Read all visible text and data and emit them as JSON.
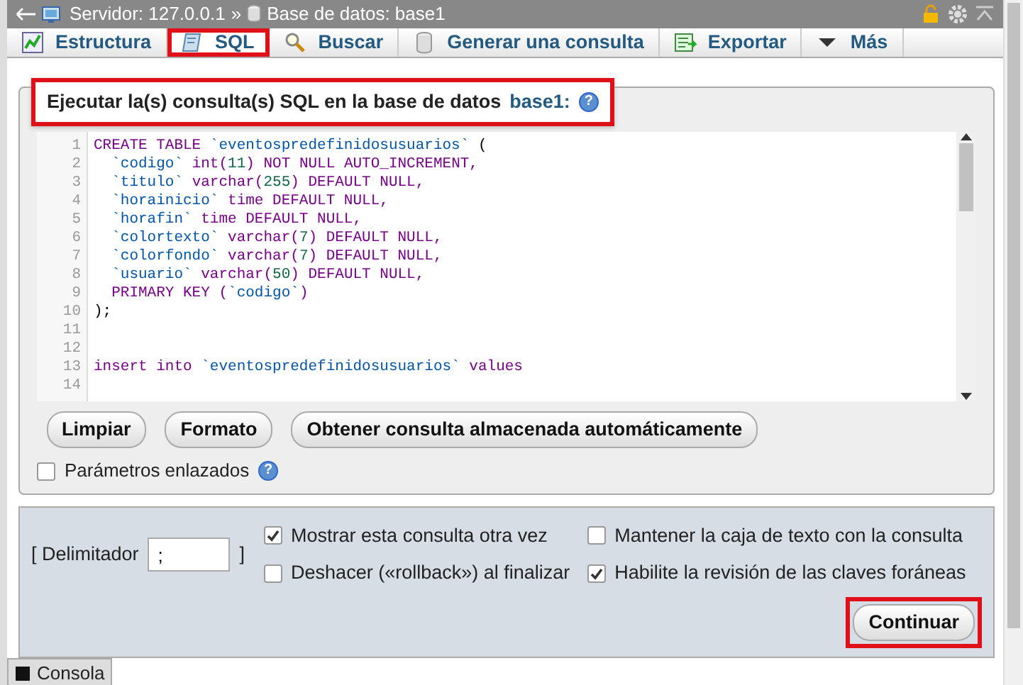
{
  "breadcrumb": {
    "server": "Servidor: 127.0.0.1",
    "separator": "»",
    "database": "Base de datos: base1"
  },
  "tabs": [
    {
      "label": "Estructura",
      "selected": false,
      "highlighted": false
    },
    {
      "label": "SQL",
      "selected": true,
      "highlighted": true
    },
    {
      "label": "Buscar",
      "selected": false,
      "highlighted": false
    },
    {
      "label": "Generar una consulta",
      "selected": false,
      "highlighted": false
    },
    {
      "label": "Exportar",
      "selected": false,
      "highlighted": false
    },
    {
      "label": "Más",
      "selected": false,
      "highlighted": false
    }
  ],
  "legend": {
    "text": "Ejecutar la(s) consulta(s) SQL en la base de datos",
    "database": "base1:",
    "help": "?",
    "highlighted": true
  },
  "editor": {
    "lines": [
      {
        "number": "1",
        "segments": [
          {
            "t": "CREATE TABLE ",
            "kind": "kw"
          },
          {
            "t": "`eventospredefinidosusuarios`",
            "kind": "name"
          },
          {
            "t": " (",
            "kind": "plain"
          }
        ]
      },
      {
        "number": "2",
        "segments": [
          {
            "t": "  `codigo`",
            "kind": "name"
          },
          {
            "t": " int(",
            "kind": "type"
          },
          {
            "t": "11",
            "kind": "num"
          },
          {
            "t": ") NOT NULL AUTO_INCREMENT,",
            "kind": "kw"
          }
        ]
      },
      {
        "number": "3",
        "segments": [
          {
            "t": "  `titulo`",
            "kind": "name"
          },
          {
            "t": " varchar(",
            "kind": "type"
          },
          {
            "t": "255",
            "kind": "num"
          },
          {
            "t": ") DEFAULT NULL,",
            "kind": "kw"
          }
        ]
      },
      {
        "number": "4",
        "segments": [
          {
            "t": "  `horainicio`",
            "kind": "name"
          },
          {
            "t": " time DEFAULT NULL,",
            "kind": "kw"
          }
        ]
      },
      {
        "number": "5",
        "segments": [
          {
            "t": "  `horafin`",
            "kind": "name"
          },
          {
            "t": " time DEFAULT NULL,",
            "kind": "kw"
          }
        ]
      },
      {
        "number": "6",
        "segments": [
          {
            "t": "  `colortexto`",
            "kind": "name"
          },
          {
            "t": " varchar(",
            "kind": "type"
          },
          {
            "t": "7",
            "kind": "num"
          },
          {
            "t": ") DEFAULT NULL,",
            "kind": "kw"
          }
        ]
      },
      {
        "number": "7",
        "segments": [
          {
            "t": "  `colorfondo`",
            "kind": "name"
          },
          {
            "t": " varchar(",
            "kind": "type"
          },
          {
            "t": "7",
            "kind": "num"
          },
          {
            "t": ") DEFAULT NULL,",
            "kind": "kw"
          }
        ]
      },
      {
        "number": "8",
        "segments": [
          {
            "t": "  `usuario`",
            "kind": "name"
          },
          {
            "t": " varchar(",
            "kind": "type"
          },
          {
            "t": "50",
            "kind": "num"
          },
          {
            "t": ") DEFAULT NULL,",
            "kind": "kw"
          }
        ]
      },
      {
        "number": "9",
        "segments": [
          {
            "t": "  PRIMARY KEY (",
            "kind": "kw"
          },
          {
            "t": "`codigo`",
            "kind": "name"
          },
          {
            "t": ")",
            "kind": "kw"
          }
        ]
      },
      {
        "number": "10",
        "segments": [
          {
            "t": ");",
            "kind": "plain"
          }
        ]
      },
      {
        "number": "11"
      },
      {
        "number": "12"
      },
      {
        "number": "13",
        "segments": [
          {
            "t": "insert into ",
            "kind": "kw"
          },
          {
            "t": "`eventospredefinidosusuarios`",
            "kind": "name"
          },
          {
            "t": " values",
            "kind": "kw"
          }
        ]
      },
      {
        "number": "14"
      }
    ]
  },
  "buttons": [
    "Limpiar",
    "Formato",
    "Obtener consulta almacenada automáticamente"
  ],
  "bind_params": {
    "label": "Parámetros enlazados",
    "help": "?",
    "checked": false
  },
  "delimiter": {
    "label_open": "[ Delimitador",
    "value": ";",
    "label_close": "]"
  },
  "options": [
    {
      "label": "Mostrar esta consulta otra vez",
      "checked": true
    },
    {
      "label": "Mantener la caja de texto con la consulta",
      "checked": false
    },
    {
      "label": "Deshacer («rollback») al finalizar",
      "checked": false
    },
    {
      "label": "Habilite la revisión de las claves foráneas",
      "checked": true
    }
  ],
  "submit": {
    "label": "Continuar",
    "highlighted": true
  },
  "console": {
    "label": "Consola"
  }
}
